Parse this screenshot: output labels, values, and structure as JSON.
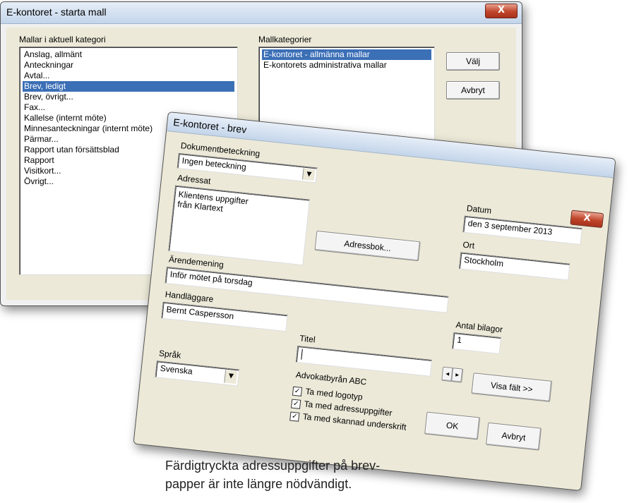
{
  "back_window": {
    "title": "E-kontoret - starta mall",
    "close": "X",
    "templates_label": "Mallar i aktuell kategori",
    "templates": [
      "Anslag, allmänt",
      "Anteckningar",
      "Avtal...",
      "Brev, ledigt",
      "Brev, övrigt...",
      "Fax...",
      "Kallelse (internt möte)",
      "Minnesanteckningar (internt möte)",
      "Pärmar...",
      "Rapport utan försättsblad",
      "Rapport",
      "Visitkort...",
      "Övrigt..."
    ],
    "selected_template_index": 3,
    "categories_label": "Mallkategorier",
    "categories": [
      "E-kontoret - allmänna mallar",
      "E-kontorets administrativa mallar"
    ],
    "selected_category_index": 0,
    "choose_button": "Välj",
    "cancel_button": "Avbryt"
  },
  "front_window": {
    "title": "E-kontoret - brev",
    "close": "X",
    "doc_label": "Dokumentbeteckning",
    "doc_value": "Ingen beteckning",
    "addressee_label": "Adressat",
    "addressee_lines": [
      "Klientens uppgifter",
      "från Klartext"
    ],
    "address_book_button": "Adressbok...",
    "date_label": "Datum",
    "date_value": "den 3 september 2013",
    "place_label": "Ort",
    "place_value": "Stockholm",
    "subject_label": "Ärendemening",
    "subject_value": "Inför mötet på torsdag",
    "handler_label": "Handläggare",
    "handler_value": "Bernt Caspersson",
    "attachments_label": "Antal bilagor",
    "attachments_value": "1",
    "title_label": "Titel",
    "title_value": "",
    "language_label": "Språk",
    "language_value": "Svenska",
    "company": "Advokatbyrån ABC",
    "checkboxes": [
      "Ta med logotyp",
      "Ta med adressuppgifter",
      "Ta med skannad underskrift"
    ],
    "nav_left": "◄",
    "nav_right": "►",
    "show_fields_button": "Visa fält >>",
    "ok_button": "OK",
    "cancel_button": "Avbryt"
  },
  "caption_lines": [
    "Färdigtryckta adressuppgifter på brev-",
    "papper är inte längre nödvändigt."
  ]
}
